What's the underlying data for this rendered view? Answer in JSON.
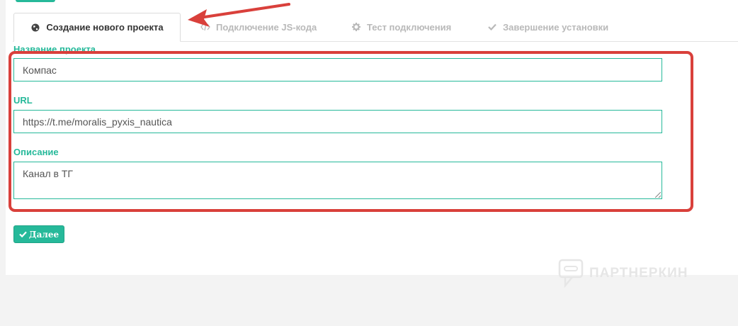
{
  "tabs": [
    {
      "label": "Создание нового проекта",
      "icon": "globe-icon",
      "active": true
    },
    {
      "label": "Подключение JS-кода",
      "icon": "code-icon",
      "active": false
    },
    {
      "label": "Тест подключения",
      "icon": "gear-icon",
      "active": false
    },
    {
      "label": "Завершение установки",
      "icon": "check-icon",
      "active": false
    }
  ],
  "form": {
    "name_label": "Название проекта",
    "name_value": "Компас",
    "url_label": "URL",
    "url_value": "https://t.me/moralis_pyxis_nautica",
    "description_label": "Описание",
    "description_value": "Канал в ТГ"
  },
  "next_button": {
    "label": "Далее",
    "icon": "check-icon"
  },
  "watermark": {
    "text": "ПАРТНЕРКИН"
  },
  "colors": {
    "accent": "#26b99a",
    "annotation": "#d9403b",
    "background": "#f3f3f3"
  }
}
